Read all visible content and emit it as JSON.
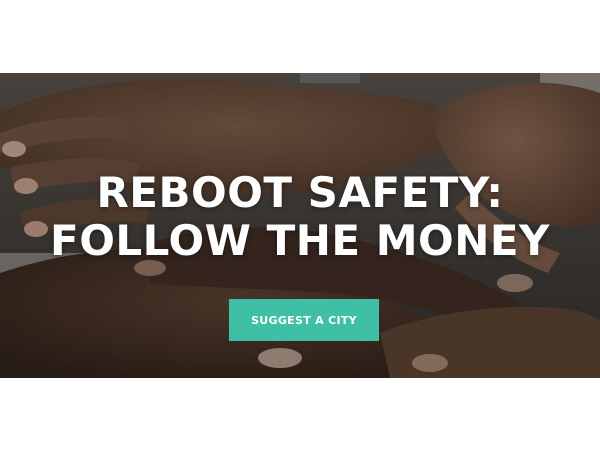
{
  "hero": {
    "title_line1": "REBOOT SAFETY:",
    "title_line2": "FOLLOW THE MONEY",
    "button_label": "SUGGEST A CITY"
  },
  "colors": {
    "accent": "#3fc0a6",
    "title_text": "#ffffff",
    "background": "#ffffff"
  }
}
